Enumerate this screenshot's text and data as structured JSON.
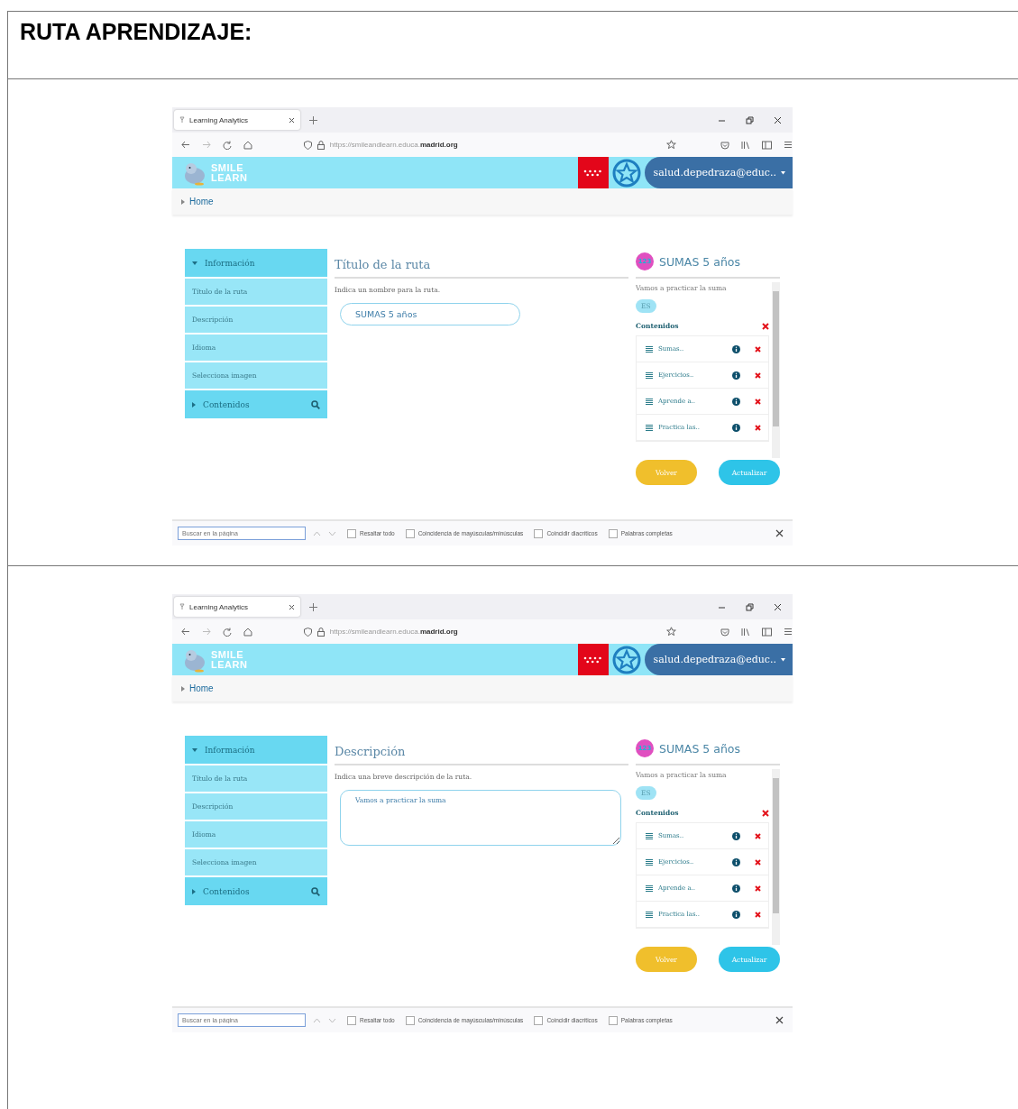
{
  "document": {
    "heading": "RUTA APRENDIZAJE:"
  },
  "shots": [
    {
      "browser": {
        "tab_title": "Learning Analytics",
        "url": "https://smileandlearn.educa.**madrid.org**"
      },
      "app": {
        "logo": [
          "SMILE",
          "LEARN"
        ],
        "user": "salud.depedraza@educ..",
        "breadcrumb": "Home"
      },
      "sidebar": [
        {
          "label": "Información",
          "expanded": true,
          "children": [
            {
              "label": "Título de la ruta"
            },
            {
              "label": "Descripción"
            },
            {
              "label": "Idioma"
            },
            {
              "label": "Selecciona imagen"
            }
          ]
        },
        {
          "label": "Contenidos",
          "expanded": false
        }
      ],
      "editor": {
        "title": "Título de la ruta",
        "hint": "Indica un nombre para la ruta.",
        "field": {
          "kind": "input",
          "value": "SUMAS 5 años"
        }
      },
      "summary": {
        "badge": "123",
        "title": "SUMAS 5 años",
        "description": "Vamos a practicar la suma",
        "language": "ES",
        "contents_heading": "Contenidos",
        "items": [
          "Sumas..",
          "Ejercicios..",
          "Aprende a..",
          "Practica las.."
        ]
      },
      "buttons": [
        "Volver",
        "Actualizar"
      ],
      "find_bar": {
        "placeholder": "Buscar en la página",
        "options": [
          {
            "label": "Resaltar todo",
            "checked": false
          },
          {
            "label": "Coincidencia de mayúsculas/minúsculas",
            "checked": false
          },
          {
            "label": "Coincidir diacríticos",
            "checked": false
          },
          {
            "label": "Palabras completas",
            "checked": false
          }
        ]
      }
    },
    {
      "browser": {
        "tab_title": "Learning Analytics",
        "url": "https://smileandlearn.educa.**madrid.org**"
      },
      "app": {
        "logo": [
          "SMILE",
          "LEARN"
        ],
        "user": "salud.depedraza@educ..",
        "breadcrumb": "Home"
      },
      "sidebar": [
        {
          "label": "Información",
          "expanded": true,
          "children": [
            {
              "label": "Título de la ruta"
            },
            {
              "label": "Descripción"
            },
            {
              "label": "Idioma"
            },
            {
              "label": "Selecciona imagen"
            }
          ]
        },
        {
          "label": "Contenidos",
          "expanded": false
        }
      ],
      "editor": {
        "title": "Descripción",
        "hint": "Indica una breve descripción de la ruta.",
        "field": {
          "kind": "textarea",
          "value": "Vamos a practicar la suma"
        }
      },
      "summary": {
        "badge": "123",
        "title": "SUMAS 5 años",
        "description": "Vamos a practicar la suma",
        "language": "ES",
        "contents_heading": "Contenidos",
        "items": [
          "Sumas..",
          "Ejercicios..",
          "Aprende a..",
          "Practica las.."
        ]
      },
      "buttons": [
        "Volver",
        "Actualizar"
      ],
      "find_bar": {
        "placeholder": "Buscar en la página",
        "options": [
          {
            "label": "Resaltar todo",
            "checked": false
          },
          {
            "label": "Coincidencia de mayúsculas/minúsculas",
            "checked": false
          },
          {
            "label": "Coincidir diacríticos",
            "checked": false
          },
          {
            "label": "Palabras completas",
            "checked": false
          }
        ]
      }
    }
  ]
}
